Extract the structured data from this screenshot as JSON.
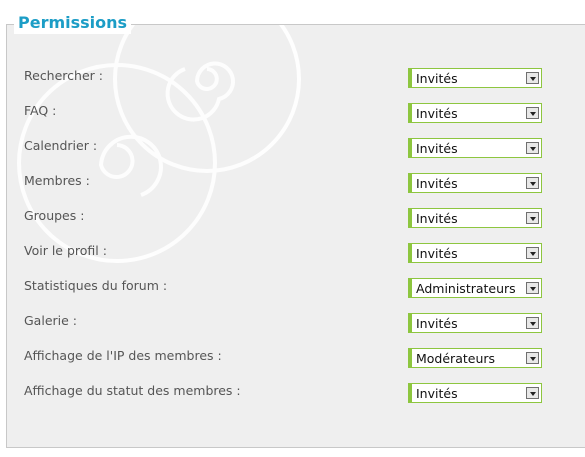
{
  "section": {
    "title": "Permissions"
  },
  "permissions": [
    {
      "label": "Rechercher :",
      "value": "Invités"
    },
    {
      "label": "FAQ :",
      "value": "Invités"
    },
    {
      "label": "Calendrier :",
      "value": "Invités"
    },
    {
      "label": "Membres :",
      "value": "Invités"
    },
    {
      "label": "Groupes :",
      "value": "Invités"
    },
    {
      "label": "Voir le profil :",
      "value": "Invités"
    },
    {
      "label": "Statistiques du forum :",
      "value": "Administrateurs"
    },
    {
      "label": "Galerie :",
      "value": "Invités"
    },
    {
      "label": "Affichage de l'IP des membres :",
      "value": "Modérateurs"
    },
    {
      "label": "Affichage du statut des membres :",
      "value": "Invités"
    }
  ],
  "colors": {
    "accent": "#1c9dc6",
    "select_border": "#8dc63f",
    "panel_bg": "#efefef"
  },
  "icons": {
    "select_arrow": "chevron-down-icon"
  }
}
